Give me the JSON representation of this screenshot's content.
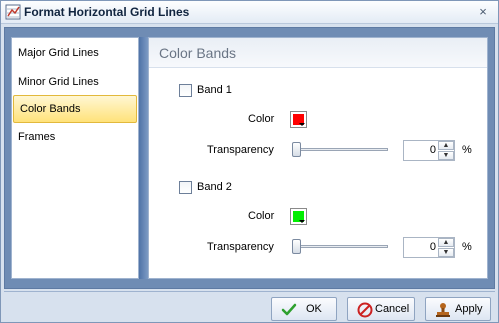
{
  "window": {
    "title": "Format Horizontal Grid Lines",
    "close_glyph": "×"
  },
  "nav": {
    "items": [
      {
        "label": "Major Grid Lines",
        "selected": false
      },
      {
        "label": "Minor Grid Lines",
        "selected": false
      },
      {
        "label": "Color Bands",
        "selected": true
      },
      {
        "label": "Frames",
        "selected": false
      }
    ]
  },
  "panel": {
    "title": "Color Bands",
    "band1": {
      "label": "Band 1",
      "checked": false,
      "color_label": "Color",
      "color": "#ff0000",
      "transparency_label": "Transparency",
      "transparency_value": "0",
      "transparency_level": 0,
      "percent": "%"
    },
    "band2": {
      "label": "Band 2",
      "checked": false,
      "color_label": "Color",
      "color": "#00ee00",
      "transparency_label": "Transparency",
      "transparency_value": "0",
      "transparency_level": 0,
      "percent": "%"
    }
  },
  "buttons": {
    "ok": "OK",
    "cancel": "Cancel",
    "apply": "Apply"
  },
  "icons": {
    "app": "grid-chart-icon",
    "ok": "checkmark-icon",
    "cancel": "no-entry-icon",
    "apply": "stamp-icon"
  },
  "colors": {
    "accent": "#6f8cb4",
    "selected_nav": "#ffe27a"
  }
}
